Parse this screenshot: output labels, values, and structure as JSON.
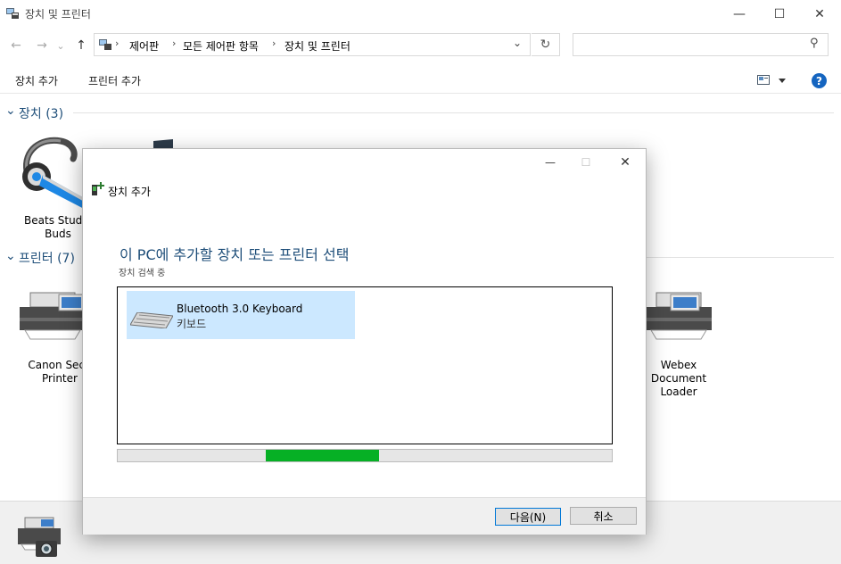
{
  "window": {
    "title": "장치 및 프린터",
    "minimize_glyph": "—",
    "maximize_glyph": "☐",
    "close_glyph": "✕"
  },
  "nav": {
    "back_glyph": "←",
    "forward_glyph": "→",
    "recent_glyph": "⌄",
    "up_glyph": "↑",
    "refresh_glyph": "↻",
    "dropdown_glyph": "⌄",
    "search_glyph": "⚲"
  },
  "breadcrumb": [
    "제어판",
    "모든 제어판 항목",
    "장치 및 프린터"
  ],
  "breadcrumb_separator": "›",
  "commands": {
    "add_device": "장치 추가",
    "add_printer": "프린터 추가",
    "help_glyph": "?"
  },
  "groups": {
    "devices": {
      "label": "장치 (3)",
      "chevron": "⌄"
    },
    "printers": {
      "label": "프린터 (7)",
      "chevron": "⌄"
    }
  },
  "devices": [
    {
      "line1": "Beats Studio",
      "line2": "Buds"
    }
  ],
  "printers": [
    {
      "line1": "Canon Secu",
      "line2": "Printer"
    },
    {
      "line1": "Webex",
      "line2": "Document",
      "line3": "Loader"
    }
  ],
  "dialog": {
    "title": "장치 추가",
    "heading": "이 PC에 추가할 장치 또는 프린터 선택",
    "status": "장치 검색 중",
    "items": [
      {
        "name": "Bluetooth 3.0 Keyboard",
        "type": "키보드"
      }
    ],
    "progress_pct": 23,
    "progress_fill_width_pct": 23,
    "next_label": "다음(N)",
    "cancel_label": "취소"
  },
  "colors": {
    "heading": "#1e4e79",
    "selection": "#cce8ff",
    "progress": "#06b025",
    "help": "#1565c0"
  }
}
